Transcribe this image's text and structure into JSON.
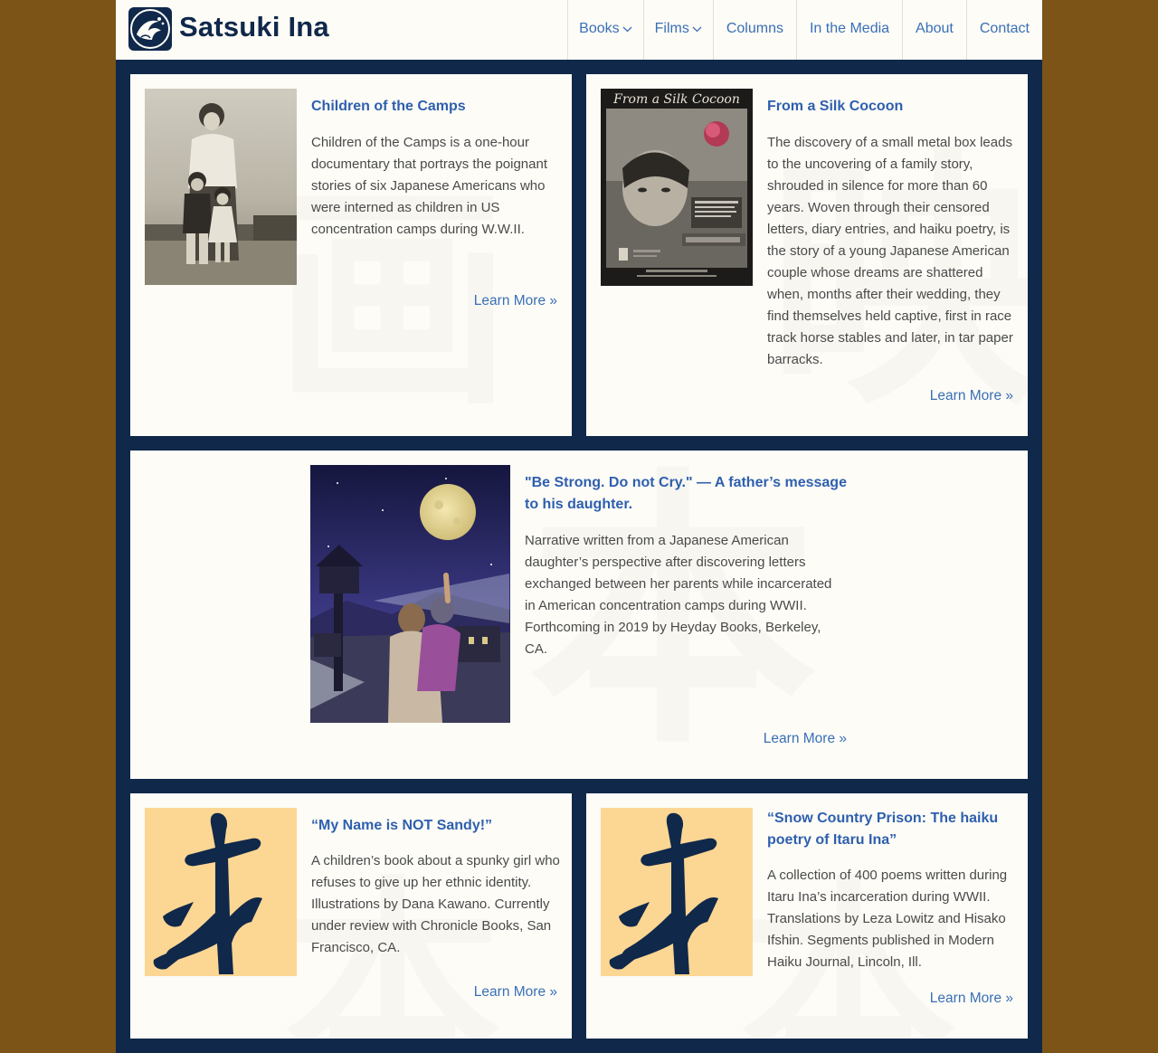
{
  "site": {
    "title": "Satsuki Ina",
    "nav": [
      {
        "label": "Books",
        "dropdown": true
      },
      {
        "label": "Films",
        "dropdown": true
      },
      {
        "label": "Columns",
        "dropdown": false
      },
      {
        "label": "In the Media",
        "dropdown": false
      },
      {
        "label": "About",
        "dropdown": false
      },
      {
        "label": "Contact",
        "dropdown": false
      }
    ]
  },
  "colors": {
    "navy": "#10284a",
    "background_brown": "#7c5418",
    "link_blue": "#3a6fb5",
    "title_blue": "#2e5fae",
    "card_bg": "#fdfcf7",
    "tan": "#fcd693"
  },
  "cards": [
    {
      "title": "Children of the Camps",
      "text": "Children of the Camps is a one-hour documentary that portrays the poignant stories of six Japanese Americans who were interned as children in US concentration camps during W.W.II.",
      "link": "Learn More »",
      "image": "vintage-family-photo"
    },
    {
      "title": "From a Silk Cocoon",
      "text": "The discovery of a small metal box leads to the uncovering of a family story, shrouded in silence for more than 60 years. Woven through their censored letters, diary entries, and haiku poetry, is the story of a young Japanese American couple whose dreams are shattered when, months after their wedding, they find themselves held captive, first in race track horse stables and later, in tar paper barracks.",
      "link": "Learn More »",
      "image": "film-poster",
      "poster_title": "From a Silk Cocoon"
    },
    {
      "title": "\"Be Strong. Do not Cry.\" — A father’s message to his daughter.",
      "text": "Narrative written from a Japanese American daughter’s perspective after discovering letters exchanged between her parents while incarcerated in American concentration camps during WWII. Forthcoming in 2019 by Heyday Books, Berkeley, CA.",
      "link": "Learn More »",
      "image": "moonlit-watchtower-illustration"
    },
    {
      "title": "“My Name is NOT Sandy!”",
      "text": "A children’s book about a spunky girl who refuses to give up her ethnic identity. Illustrations by Dana Kawano. Currently under review with Chronicle Books, San Francisco, CA.",
      "link": "Learn More »",
      "image": "book-kanji-icon"
    },
    {
      "title": "“Snow Country Prison: The haiku poetry of Itaru Ina”",
      "text": "A collection of 400 poems written during Itaru Ina’s incarceration during WWII. Translations by Leza Lowitz and Hisako Ifshin. Segments published in Modern Haiku Journal, Lincoln, Ill.",
      "link": "Learn More »",
      "image": "book-kanji-icon"
    }
  ]
}
